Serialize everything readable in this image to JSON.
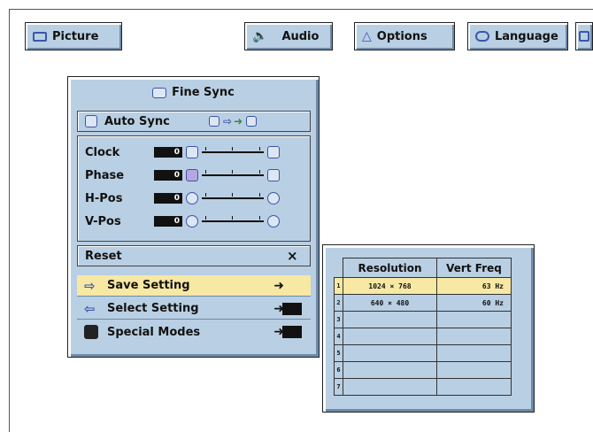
{
  "tabs": [
    {
      "label": "Picture"
    },
    {
      "label": "Audio"
    },
    {
      "label": "Options"
    },
    {
      "label": "Language"
    }
  ],
  "menu": {
    "title": "Fine Sync",
    "auto_sync": "Auto Sync",
    "adjustments": [
      {
        "label": "Clock",
        "value": "0"
      },
      {
        "label": "Phase",
        "value": "0"
      },
      {
        "label": "H-Pos",
        "value": "0"
      },
      {
        "label": "V-Pos",
        "value": "0"
      }
    ],
    "reset": {
      "label": "Reset",
      "mark": "×"
    },
    "items": [
      {
        "label": "Save Setting"
      },
      {
        "label": "Select Setting"
      },
      {
        "label": "Special Modes"
      }
    ]
  },
  "resolution_table": {
    "headers": [
      "Resolution",
      "Vert Freq"
    ],
    "rows": [
      {
        "num": "1",
        "resolution": "1024 × 768",
        "freq": "63 Hz"
      },
      {
        "num": "2",
        "resolution": "640 × 480",
        "freq": "60 Hz"
      },
      {
        "num": "3",
        "resolution": "",
        "freq": ""
      },
      {
        "num": "4",
        "resolution": "",
        "freq": ""
      },
      {
        "num": "5",
        "resolution": "",
        "freq": ""
      },
      {
        "num": "6",
        "resolution": "",
        "freq": ""
      },
      {
        "num": "7",
        "resolution": "",
        "freq": ""
      }
    ]
  }
}
